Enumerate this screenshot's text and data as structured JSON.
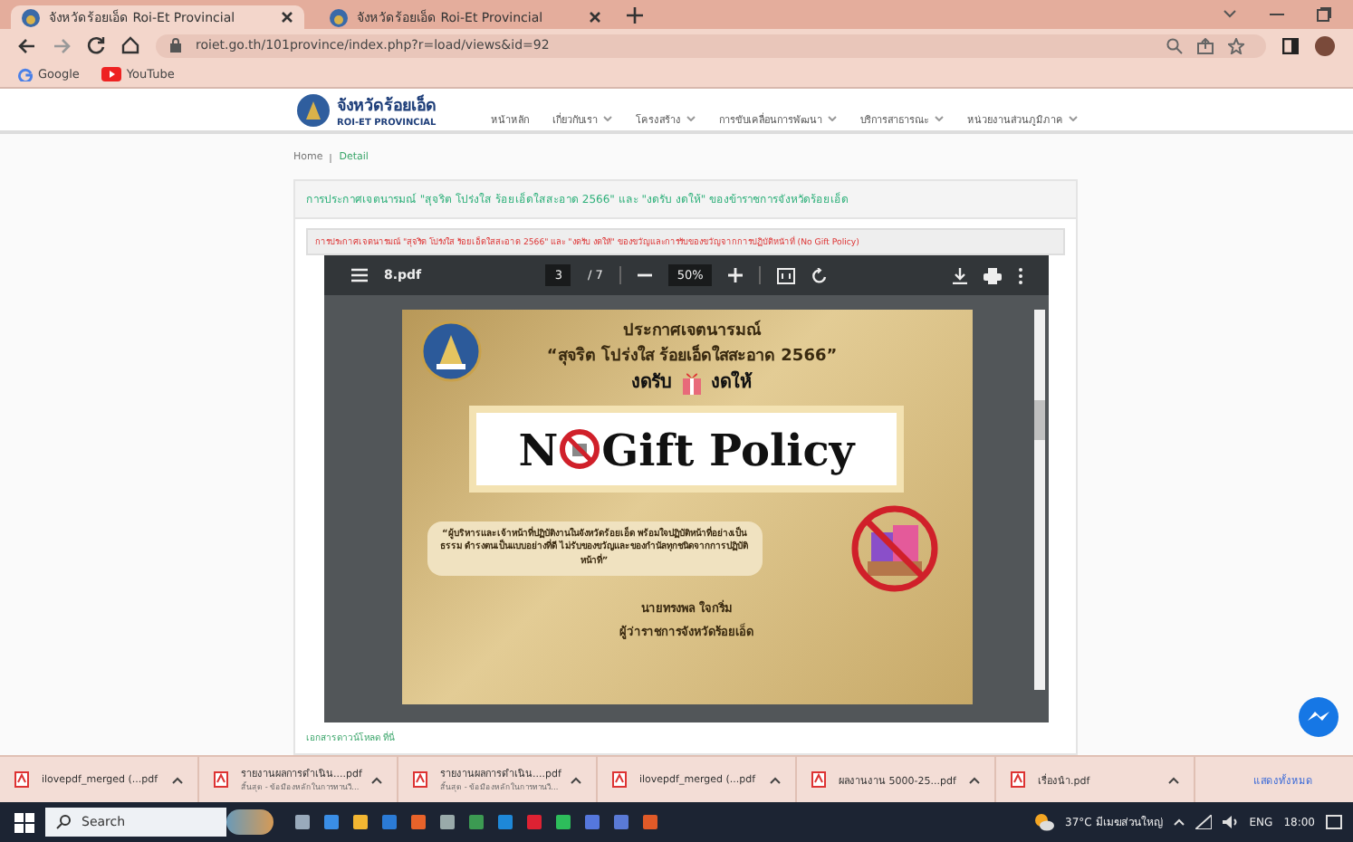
{
  "browser": {
    "tabs": [
      {
        "title": "จังหวัดร้อยเอ็ด Roi-Et Provincial",
        "selected": true
      },
      {
        "title": "จังหวัดร้อยเอ็ด Roi-Et Provincial",
        "selected": false
      }
    ],
    "url": "roiet.go.th/101province/index.php?r=load/views&id=92",
    "bookmarks": [
      {
        "label": "Google",
        "kind": "google"
      },
      {
        "label": "YouTube",
        "kind": "youtube"
      }
    ]
  },
  "site": {
    "logo": {
      "name_th": "จังหวัดร้อยเอ็ด",
      "name_en": "ROI-ET PROVINCIAL"
    },
    "nav": [
      {
        "label": "หน้าหลัก",
        "has_menu": false
      },
      {
        "label": "เกี่ยวกับเรา",
        "has_menu": true
      },
      {
        "label": "โครงสร้าง",
        "has_menu": true
      },
      {
        "label": "การขับเคลื่อนการพัฒนา",
        "has_menu": true
      },
      {
        "label": "บริการสาธารณะ",
        "has_menu": true
      },
      {
        "label": "หน่วยงานส่วนภูมิภาค",
        "has_menu": true
      }
    ],
    "breadcrumb": [
      "Home",
      "Detail"
    ],
    "heading": "การประกาศเจตนารมณ์ \"สุจริต โปร่งใส ร้อยเอ็ดใสสะอาด 2566\" และ \"งดรับ งดให้\" ของข้าราชการจังหวัดร้อยเอ็ด",
    "subheading": "การประกาศเจตนารมณ์ \"สุจริต โปร่งใส ร้อยเอ็ดใสสะอาด 2566\" และ \"งดรับ งดให้\" ของขวัญและการรับของขวัญจากการปฏิบัติหน้าที่ (No Gift Policy)",
    "link": "เอกสารดาวน์โหลด ที่นี่"
  },
  "pdf_viewer": {
    "filename": "8.pdf",
    "page": "3",
    "page_count": "/ 7",
    "zoom": "50%",
    "poster": {
      "title": "ประกาศเจตนารมณ์",
      "slogan": "“สุจริต โปร่งใส ร้อยเอ็ดใสสะอาด 2566”",
      "no_take": "งดรับ",
      "no_give": "งดให้",
      "banner_letter": "N",
      "banner_text": "Gift Policy",
      "quote": "“ผู้บริหารและเจ้าหน้าที่ปฏิบัติงานในจังหวัดร้อยเอ็ด พร้อมใจปฏิบัติหน้าที่อย่างเป็นธรรม ดำรงตนเป็นแบบอย่างที่ดี ไม่รับของขวัญและของกำนัลทุกชนิดจากการปฏิบัติหน้าที่”",
      "signer": "นายทรงพล ใจกริ่ม",
      "signer_title": "ผู้ว่าราชการจังหวัดร้อยเอ็ด"
    }
  },
  "downloads": {
    "items": [
      {
        "name": "ilovepdf_merged (...pdf"
      },
      {
        "name": "รายงานผลการดำเนิน....pdf",
        "detail": "สิ้นสุด - ข้อมืองหลักในการทานวี..."
      },
      {
        "name": "รายงานผลการดำเนิน....pdf",
        "detail": "สิ้นสุด - ข้อมืองหลักในการทานวี..."
      },
      {
        "name": "ilovepdf_merged (...pdf"
      },
      {
        "name": "ผลงานงาน 5000-25...pdf"
      },
      {
        "name": "เรื่องนำ.pdf"
      }
    ],
    "show_all": "แสดงทั้งหมด"
  },
  "taskbar": {
    "search": "Search",
    "weather": "37°C มีเมฆส่วนใหญ่",
    "language": "ENG",
    "time": "18:00"
  }
}
